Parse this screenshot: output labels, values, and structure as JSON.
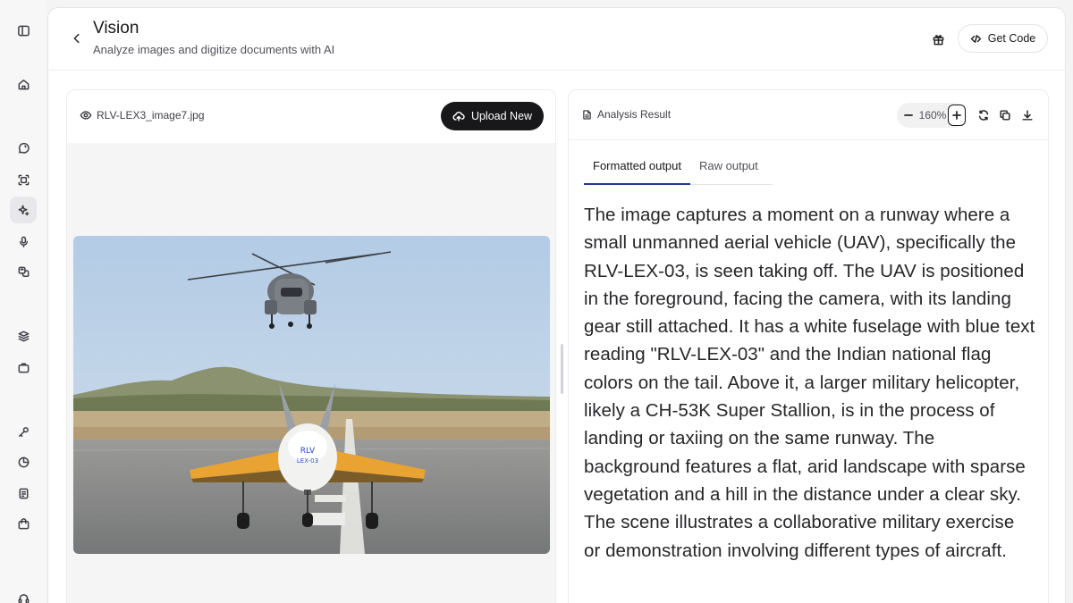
{
  "header": {
    "title": "Vision",
    "subtitle": "Analyze images and digitize documents with AI",
    "get_code_label": "Get Code"
  },
  "sidebar": {
    "items": [
      {
        "icon": "panel-toggle-icon"
      },
      {
        "icon": "home-icon"
      },
      {
        "icon": "chat-icon"
      },
      {
        "icon": "frame-icon"
      },
      {
        "icon": "sparkle-icon",
        "active": true
      },
      {
        "icon": "microphone-icon"
      },
      {
        "icon": "translate-icon"
      },
      {
        "icon": "layers-icon"
      },
      {
        "icon": "briefcase-icon"
      },
      {
        "icon": "key-icon"
      },
      {
        "icon": "usage-icon"
      },
      {
        "icon": "document-icon"
      },
      {
        "icon": "bag-icon"
      },
      {
        "icon": "support-icon"
      }
    ]
  },
  "image_panel": {
    "file_name": "RLV-LEX3_image7.jpg",
    "upload_label": "Upload New"
  },
  "result_panel": {
    "label": "Analysis Result",
    "zoom": "160%",
    "tabs": [
      "Formatted output",
      "Raw output"
    ],
    "active_tab": "Formatted output",
    "text": "The image captures a moment on a runway where a small unmanned aerial vehicle (UAV), specifically the RLV-LEX-03, is seen taking off. The UAV is positioned in the foreground, facing the camera, with its landing gear still attached. It has a white fuselage with blue text reading \"RLV-LEX-03\" and the Indian national flag colors on the tail. Above it, a larger military helicopter, likely a CH-53K Super Stallion, is in the process of landing or taxiing on the same runway. The background features a flat, arid landscape with sparse vegetation and a hill in the distance under a clear sky. The scene illustrates a collaborative military exercise or demonstration involving different types of aircraft."
  },
  "colors": {
    "accent_tab_underline": "#1e3a8a",
    "primary_button": "#18181b",
    "sky": "#b9cfe6",
    "runway": "#8e8f8f",
    "wing_orange": "#e8a332"
  }
}
